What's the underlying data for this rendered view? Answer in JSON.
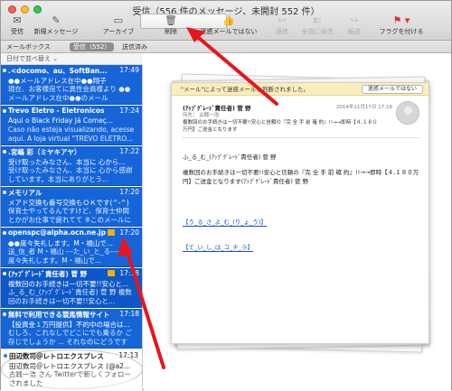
{
  "window": {
    "title": "受信（556 件のメッセージ、未開封 552 件）"
  },
  "toolbar": {
    "get_mail": "受信",
    "new_message": "新規メッセージ",
    "archive": "アーカイブ",
    "delete": "削除",
    "not_junk": "迷惑メールではない",
    "reply": "返信",
    "reply_all": "全員に返信",
    "forward": "転送",
    "flag": "フラグを付ける"
  },
  "favorites": {
    "mailboxes": "メールボックス",
    "inbox": "受信（552）",
    "sent": "送信済み"
  },
  "sort_label": "日付で並べ替え ⌄",
  "messages": [
    {
      "sender": ".<docomo、au、SoftBan...",
      "time": "17:49",
      "subject": "●●メールアドレス在中●●翔子",
      "preview": "現在、お客様宛てに異性会員様より ●●メールアドレス在中●●のメール"
    },
    {
      "sender": "Trevo Eletro - Eletronicos",
      "time": "17:24",
      "subject": "Aqui o Black Friday Já Começ...",
      "preview": "Caso não esteja visualizando, acesse aqui. A loja virtual \"TREVO ELETRO..."
    },
    {
      "sender": ".宮嶋 彩（ミヤキアヤ）",
      "time": "17:22",
      "subject": "受け取ったみなさん、本当に 心から...",
      "preview": "受け取ったみなさん、本当に 心から感謝しています。本当にありがとう..."
    },
    {
      "sender": "メモリアル",
      "time": "17:20",
      "subject": "メアド交換も番号交換もＯＫです(^-^)",
      "preview": "保育士やってるんですけど、保育士仲間とかがお仕事で疲れてて ※このメールには画像が添付されています"
    },
    {
      "sender": "openspc@alpha.ocn.ne.jp",
      "time": "17:20",
      "subject": "●●度々失礼します。M・福山で...",
      "preview": "送_信_者 M・福山 ---た_い_と_る---- 度々失礼します。M・福山で..."
    },
    {
      "sender": "(ｱｯﾌﾟｸﾞﾚｰﾄﾞ責任者) 菅 野",
      "time": "17:18",
      "subject": "複数回のお手続きは一切不要!!安心と...",
      "preview": "ふ_る_む_(ｱｯﾌﾟｸﾞﾚｰﾄﾞ責任者) 菅 野 複数回のお手続きは一切不要!!安心と..."
    },
    {
      "sender": "無料で利用できる競馬情報サイト",
      "time": "17:18",
      "subject": "【投資金１万円提供】不的中の場合は...",
      "preview": "むしろ、これなしでどこにでも乗るか ご存じでしょうか ...  それなのにどうです"
    },
    {
      "sender": "田辺数司＠レトロエクスプレス",
      "time": "17:13",
      "subject": "田辺数司＠レトロエクスプレス (@a2...",
      "preview": "古践一浩 さん Twitterで新しくフォローされました"
    }
  ],
  "preview": {
    "junk_notice": "\"メール\"によって迷惑メールと判断されました。",
    "not_junk_button": "迷惑メールではない",
    "sender": "(ｱｯﾌﾟｸﾞﾚｰﾄﾞ責任者) 菅 野",
    "date": "2014年11月17日 17:18",
    "to": "宛先：  古賤一浩",
    "subject": "複数回のお手続きは一切不要!!安心と信頼の『完 全 手 前 確 約』!!→→即時【４,１８０万円】ご送金となります",
    "greeting": "ふ_る_む_(ｱｯﾌﾟｸﾞﾚｰﾄﾞ責任者) 菅 野",
    "body": "複数回のお手続きは一切不要!!安心と信頼の『完 全 手 前 確 約』!!→→即時【４,１８０万円】ご送金となります(ｱｯﾌﾟｸﾞﾚｰﾄﾞ責任者) 菅 野",
    "link1": "【う_る_さ_よ_む_(り_ょ_う)】",
    "link2": "【て_い_し_は_コ_チ_ラ】"
  }
}
